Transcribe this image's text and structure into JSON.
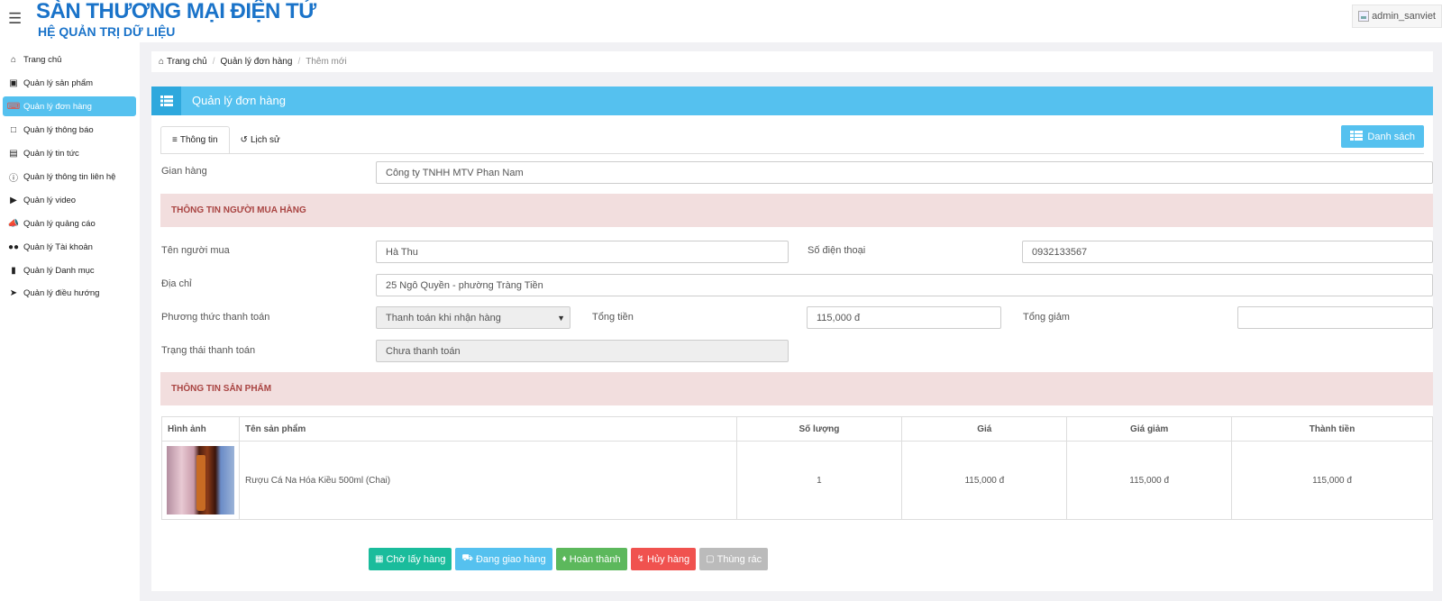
{
  "header": {
    "title": "SÀN THƯƠNG MẠI ĐIỆN TỬ",
    "subtitle": "HỆ QUẢN TRỊ DỮ LIỆU",
    "user": "admin_sanviet"
  },
  "sidebar": {
    "items": [
      {
        "label": "Trang chủ",
        "icon": "home-icon"
      },
      {
        "label": "Quản lý sản phẩm",
        "icon": "archive-icon"
      },
      {
        "label": "Quản lý đơn hàng",
        "icon": "order-icon",
        "active": true
      },
      {
        "label": "Quản lý thông báo",
        "icon": "bookmark-icon"
      },
      {
        "label": "Quản lý tin tức",
        "icon": "news-icon"
      },
      {
        "label": "Quản lý thông tin liên hệ",
        "icon": "question-icon"
      },
      {
        "label": "Quản lý video",
        "icon": "video-icon"
      },
      {
        "label": "Quản lý quảng cáo",
        "icon": "bullhorn-icon"
      },
      {
        "label": "Quản lý Tài khoản",
        "icon": "users-icon"
      },
      {
        "label": "Quản lý Danh mục",
        "icon": "folder-icon"
      },
      {
        "label": "Quản lý điều hướng",
        "icon": "location-arrow-icon"
      }
    ]
  },
  "breadcrumb": {
    "home": "Trang chủ",
    "section": "Quản lý đơn hàng",
    "current": "Thêm mới"
  },
  "panel": {
    "title": "Quản lý đơn hàng",
    "tabs": [
      "Thông tin",
      "Lịch sử"
    ],
    "list_button": "Danh sách"
  },
  "form": {
    "store_label": "Gian hàng",
    "store_value": "Công ty TNHH MTV Phan Nam",
    "buyer_section": "THÔNG TIN NGƯỜI MUA HÀNG",
    "buyer_name_label": "Tên người mua",
    "buyer_name_value": "Hà Thu",
    "phone_label": "Số điện thoại",
    "phone_value": "0932133567",
    "address_label": "Địa chỉ",
    "address_value": "25 Ngô Quyền - phường Tràng Tiền",
    "payment_method_label": "Phương thức thanh toán",
    "payment_method_value": "Thanh toán khi nhận hàng",
    "total_label": "Tổng tiền",
    "total_value": "115,000 đ",
    "discount_label": "Tổng giảm",
    "discount_value": "",
    "payment_status_label": "Trạng thái thanh toán",
    "payment_status_value": "Chưa thanh toán",
    "product_section": "THÔNG TIN SẢN PHẨM"
  },
  "table": {
    "headers": [
      "Hình ảnh",
      "Tên sản phẩm",
      "Số lượng",
      "Giá",
      "Giá giảm",
      "Thành tiền"
    ],
    "rows": [
      {
        "name": "Rượu Cá Na Hóa Kiều 500ml (Chai)",
        "qty": "1",
        "price": "115,000 đ",
        "discount_price": "115,000 đ",
        "amount": "115,000 đ"
      }
    ]
  },
  "actions": {
    "pickup": "Chờ lấy hàng",
    "shipping": "Đang giao hàng",
    "done": "Hoàn thành",
    "cancel": "Hủy hàng",
    "trash": "Thùng rác"
  },
  "colors": {
    "brand": "#1a73c9",
    "accent": "#55c1ef",
    "success": "#5cb85c",
    "danger": "#f0524f",
    "disabled": "#bbbbbb",
    "section_bg": "#f2dede",
    "section_text": "#a94442"
  }
}
